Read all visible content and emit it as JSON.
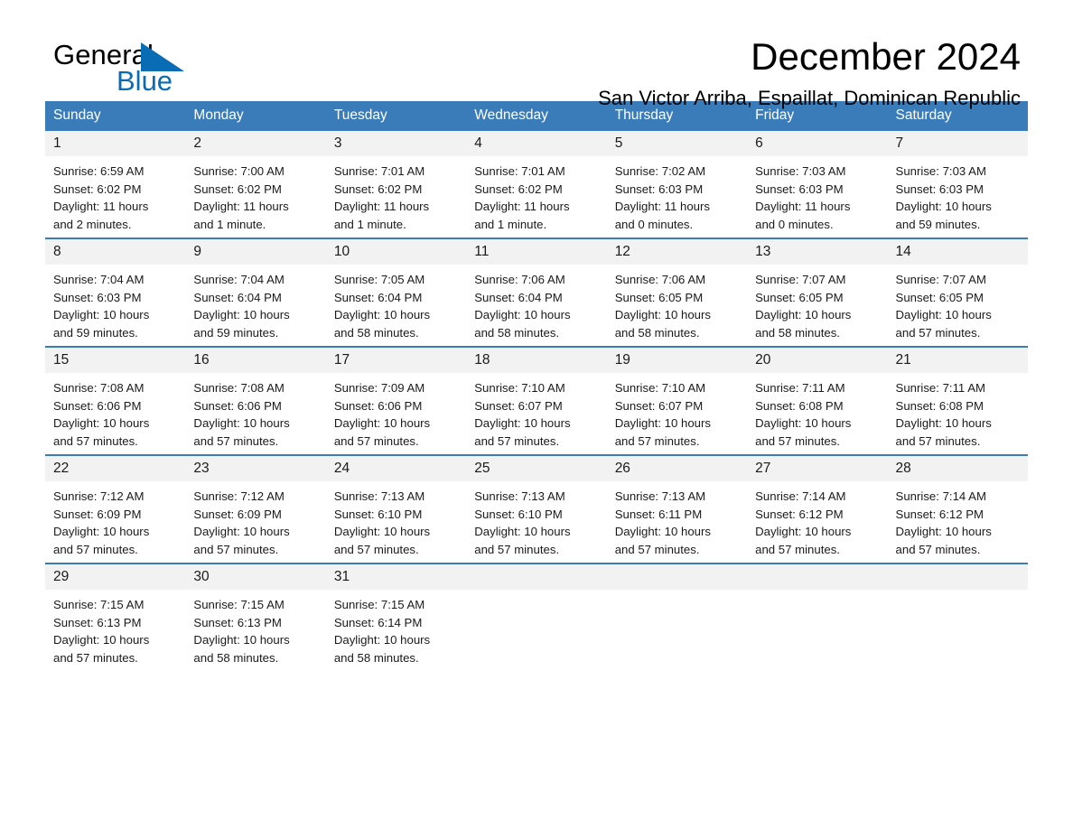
{
  "brand": {
    "name_part1": "General",
    "name_part2": "Blue",
    "triangle_icon": "blue-triangle-icon",
    "accent_color": "#0a6cb4"
  },
  "header": {
    "title": "December 2024",
    "subtitle": "San Victor Arriba, Espaillat, Dominican Republic"
  },
  "theme": {
    "header_row_bg": "#3a7cba",
    "daynum_bg": "#f2f2f2",
    "row_border": "#3a7cba",
    "text": "#1a1a1a"
  },
  "weekdays": [
    "Sunday",
    "Monday",
    "Tuesday",
    "Wednesday",
    "Thursday",
    "Friday",
    "Saturday"
  ],
  "weeks": [
    [
      {
        "day": "1",
        "sunrise": "Sunrise: 6:59 AM",
        "sunset": "Sunset: 6:02 PM",
        "daylight_l1": "Daylight: 11 hours",
        "daylight_l2": "and 2 minutes."
      },
      {
        "day": "2",
        "sunrise": "Sunrise: 7:00 AM",
        "sunset": "Sunset: 6:02 PM",
        "daylight_l1": "Daylight: 11 hours",
        "daylight_l2": "and 1 minute."
      },
      {
        "day": "3",
        "sunrise": "Sunrise: 7:01 AM",
        "sunset": "Sunset: 6:02 PM",
        "daylight_l1": "Daylight: 11 hours",
        "daylight_l2": "and 1 minute."
      },
      {
        "day": "4",
        "sunrise": "Sunrise: 7:01 AM",
        "sunset": "Sunset: 6:02 PM",
        "daylight_l1": "Daylight: 11 hours",
        "daylight_l2": "and 1 minute."
      },
      {
        "day": "5",
        "sunrise": "Sunrise: 7:02 AM",
        "sunset": "Sunset: 6:03 PM",
        "daylight_l1": "Daylight: 11 hours",
        "daylight_l2": "and 0 minutes."
      },
      {
        "day": "6",
        "sunrise": "Sunrise: 7:03 AM",
        "sunset": "Sunset: 6:03 PM",
        "daylight_l1": "Daylight: 11 hours",
        "daylight_l2": "and 0 minutes."
      },
      {
        "day": "7",
        "sunrise": "Sunrise: 7:03 AM",
        "sunset": "Sunset: 6:03 PM",
        "daylight_l1": "Daylight: 10 hours",
        "daylight_l2": "and 59 minutes."
      }
    ],
    [
      {
        "day": "8",
        "sunrise": "Sunrise: 7:04 AM",
        "sunset": "Sunset: 6:03 PM",
        "daylight_l1": "Daylight: 10 hours",
        "daylight_l2": "and 59 minutes."
      },
      {
        "day": "9",
        "sunrise": "Sunrise: 7:04 AM",
        "sunset": "Sunset: 6:04 PM",
        "daylight_l1": "Daylight: 10 hours",
        "daylight_l2": "and 59 minutes."
      },
      {
        "day": "10",
        "sunrise": "Sunrise: 7:05 AM",
        "sunset": "Sunset: 6:04 PM",
        "daylight_l1": "Daylight: 10 hours",
        "daylight_l2": "and 58 minutes."
      },
      {
        "day": "11",
        "sunrise": "Sunrise: 7:06 AM",
        "sunset": "Sunset: 6:04 PM",
        "daylight_l1": "Daylight: 10 hours",
        "daylight_l2": "and 58 minutes."
      },
      {
        "day": "12",
        "sunrise": "Sunrise: 7:06 AM",
        "sunset": "Sunset: 6:05 PM",
        "daylight_l1": "Daylight: 10 hours",
        "daylight_l2": "and 58 minutes."
      },
      {
        "day": "13",
        "sunrise": "Sunrise: 7:07 AM",
        "sunset": "Sunset: 6:05 PM",
        "daylight_l1": "Daylight: 10 hours",
        "daylight_l2": "and 58 minutes."
      },
      {
        "day": "14",
        "sunrise": "Sunrise: 7:07 AM",
        "sunset": "Sunset: 6:05 PM",
        "daylight_l1": "Daylight: 10 hours",
        "daylight_l2": "and 57 minutes."
      }
    ],
    [
      {
        "day": "15",
        "sunrise": "Sunrise: 7:08 AM",
        "sunset": "Sunset: 6:06 PM",
        "daylight_l1": "Daylight: 10 hours",
        "daylight_l2": "and 57 minutes."
      },
      {
        "day": "16",
        "sunrise": "Sunrise: 7:08 AM",
        "sunset": "Sunset: 6:06 PM",
        "daylight_l1": "Daylight: 10 hours",
        "daylight_l2": "and 57 minutes."
      },
      {
        "day": "17",
        "sunrise": "Sunrise: 7:09 AM",
        "sunset": "Sunset: 6:06 PM",
        "daylight_l1": "Daylight: 10 hours",
        "daylight_l2": "and 57 minutes."
      },
      {
        "day": "18",
        "sunrise": "Sunrise: 7:10 AM",
        "sunset": "Sunset: 6:07 PM",
        "daylight_l1": "Daylight: 10 hours",
        "daylight_l2": "and 57 minutes."
      },
      {
        "day": "19",
        "sunrise": "Sunrise: 7:10 AM",
        "sunset": "Sunset: 6:07 PM",
        "daylight_l1": "Daylight: 10 hours",
        "daylight_l2": "and 57 minutes."
      },
      {
        "day": "20",
        "sunrise": "Sunrise: 7:11 AM",
        "sunset": "Sunset: 6:08 PM",
        "daylight_l1": "Daylight: 10 hours",
        "daylight_l2": "and 57 minutes."
      },
      {
        "day": "21",
        "sunrise": "Sunrise: 7:11 AM",
        "sunset": "Sunset: 6:08 PM",
        "daylight_l1": "Daylight: 10 hours",
        "daylight_l2": "and 57 minutes."
      }
    ],
    [
      {
        "day": "22",
        "sunrise": "Sunrise: 7:12 AM",
        "sunset": "Sunset: 6:09 PM",
        "daylight_l1": "Daylight: 10 hours",
        "daylight_l2": "and 57 minutes."
      },
      {
        "day": "23",
        "sunrise": "Sunrise: 7:12 AM",
        "sunset": "Sunset: 6:09 PM",
        "daylight_l1": "Daylight: 10 hours",
        "daylight_l2": "and 57 minutes."
      },
      {
        "day": "24",
        "sunrise": "Sunrise: 7:13 AM",
        "sunset": "Sunset: 6:10 PM",
        "daylight_l1": "Daylight: 10 hours",
        "daylight_l2": "and 57 minutes."
      },
      {
        "day": "25",
        "sunrise": "Sunrise: 7:13 AM",
        "sunset": "Sunset: 6:10 PM",
        "daylight_l1": "Daylight: 10 hours",
        "daylight_l2": "and 57 minutes."
      },
      {
        "day": "26",
        "sunrise": "Sunrise: 7:13 AM",
        "sunset": "Sunset: 6:11 PM",
        "daylight_l1": "Daylight: 10 hours",
        "daylight_l2": "and 57 minutes."
      },
      {
        "day": "27",
        "sunrise": "Sunrise: 7:14 AM",
        "sunset": "Sunset: 6:12 PM",
        "daylight_l1": "Daylight: 10 hours",
        "daylight_l2": "and 57 minutes."
      },
      {
        "day": "28",
        "sunrise": "Sunrise: 7:14 AM",
        "sunset": "Sunset: 6:12 PM",
        "daylight_l1": "Daylight: 10 hours",
        "daylight_l2": "and 57 minutes."
      }
    ],
    [
      {
        "day": "29",
        "sunrise": "Sunrise: 7:15 AM",
        "sunset": "Sunset: 6:13 PM",
        "daylight_l1": "Daylight: 10 hours",
        "daylight_l2": "and 57 minutes."
      },
      {
        "day": "30",
        "sunrise": "Sunrise: 7:15 AM",
        "sunset": "Sunset: 6:13 PM",
        "daylight_l1": "Daylight: 10 hours",
        "daylight_l2": "and 58 minutes."
      },
      {
        "day": "31",
        "sunrise": "Sunrise: 7:15 AM",
        "sunset": "Sunset: 6:14 PM",
        "daylight_l1": "Daylight: 10 hours",
        "daylight_l2": "and 58 minutes."
      },
      {
        "day": "",
        "sunrise": "",
        "sunset": "",
        "daylight_l1": "",
        "daylight_l2": ""
      },
      {
        "day": "",
        "sunrise": "",
        "sunset": "",
        "daylight_l1": "",
        "daylight_l2": ""
      },
      {
        "day": "",
        "sunrise": "",
        "sunset": "",
        "daylight_l1": "",
        "daylight_l2": ""
      },
      {
        "day": "",
        "sunrise": "",
        "sunset": "",
        "daylight_l1": "",
        "daylight_l2": ""
      }
    ]
  ]
}
